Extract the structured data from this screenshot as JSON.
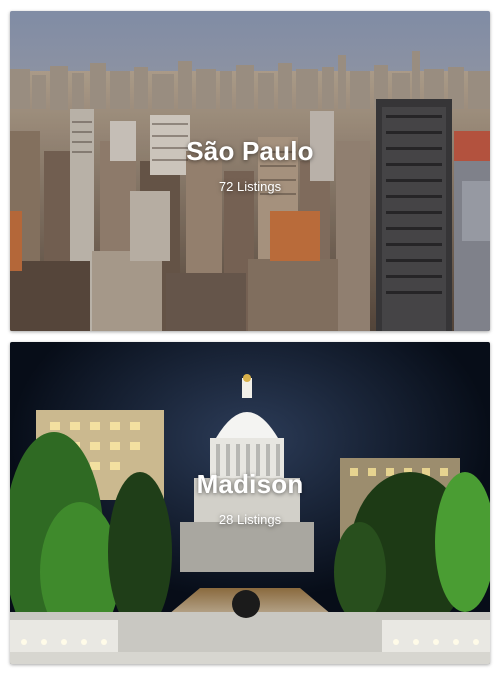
{
  "cities": [
    {
      "name": "São Paulo",
      "listings": "72 Listings"
    },
    {
      "name": "Madison",
      "listings": "28 Listings"
    }
  ],
  "colors": {
    "sao_paulo_sky": "#7d8aa4",
    "madison_sky": "#0b1626",
    "text": "#ffffff"
  }
}
